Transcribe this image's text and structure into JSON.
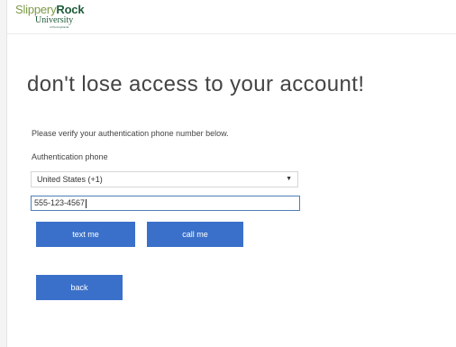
{
  "logo": {
    "line1_part1": "Slippery",
    "line1_part2": "Rock",
    "line2": "University",
    "line3": "of Pennsylvania"
  },
  "page": {
    "title": "don't lose access to your account!",
    "instruction": "Please verify your authentication phone number below.",
    "phone_label": "Authentication phone"
  },
  "country_select": {
    "selected": "United States (+1)",
    "arrow": "▼"
  },
  "phone_input": {
    "value": "555-123-4567"
  },
  "buttons": {
    "text_me": "text me",
    "call_me": "call me",
    "back": "back"
  },
  "colors": {
    "button_blue": "#3a70c9",
    "input_focus_border": "#4d7fb6",
    "logo_green_dark": "#1f5c3a",
    "logo_green_light": "#7c9a46"
  }
}
